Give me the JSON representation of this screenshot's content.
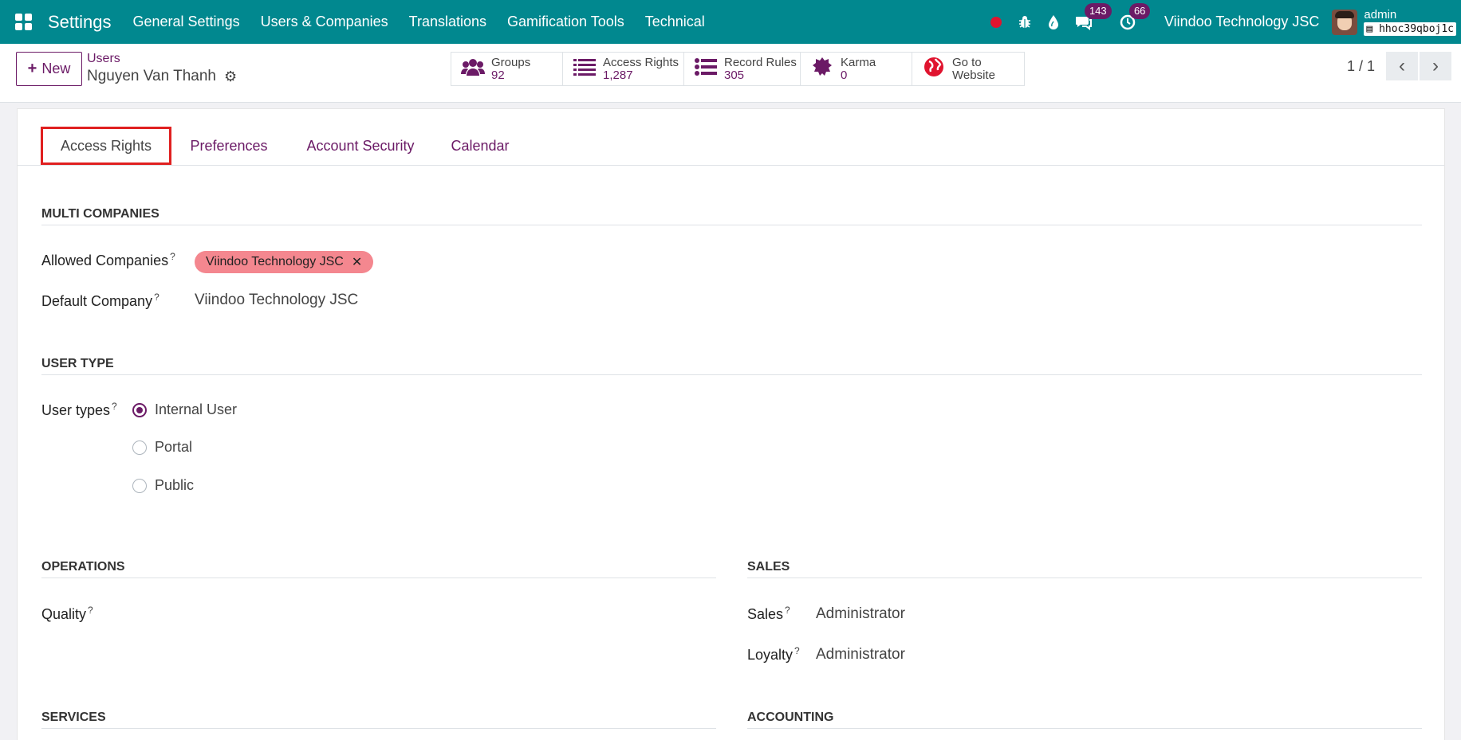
{
  "navbar": {
    "app_title": "Settings",
    "menu": [
      "General Settings",
      "Users & Companies",
      "Translations",
      "Gamification Tools",
      "Technical"
    ],
    "messages_badge": "143",
    "activities_badge": "66",
    "company": "Viindoo Technology JSC",
    "user": "admin",
    "database": "hhoc39qboj1c"
  },
  "control": {
    "new_label": "New",
    "breadcrumb": "Users",
    "record_name": "Nguyen Van Thanh",
    "stats": [
      {
        "label": "Groups",
        "value": "92",
        "icon": "users-icon"
      },
      {
        "label": "Access Rights",
        "value": "1,287",
        "icon": "list-icon"
      },
      {
        "label": "Record Rules",
        "value": "305",
        "icon": "list-icon"
      },
      {
        "label": "Karma",
        "value": "0",
        "icon": "karma-icon"
      },
      {
        "label": "Go to",
        "value": "Website",
        "icon": "globe-icon"
      }
    ],
    "pager": "1 / 1"
  },
  "tabs": [
    "Access Rights",
    "Preferences",
    "Account Security",
    "Calendar"
  ],
  "form": {
    "multi_companies": {
      "title": "MULTI COMPANIES",
      "allowed_label": "Allowed Companies",
      "allowed_tag": "Viindoo Technology JSC",
      "default_label": "Default Company",
      "default_value": "Viindoo Technology JSC"
    },
    "user_type": {
      "title": "USER TYPE",
      "label": "User types",
      "options": [
        "Internal User",
        "Portal",
        "Public"
      ],
      "selected": "Internal User"
    },
    "operations": {
      "title": "OPERATIONS",
      "quality_label": "Quality"
    },
    "sales": {
      "title": "SALES",
      "sales_label": "Sales",
      "sales_value": "Administrator",
      "loyalty_label": "Loyalty",
      "loyalty_value": "Administrator"
    },
    "services": {
      "title": "SERVICES"
    },
    "accounting": {
      "title": "ACCOUNTING"
    }
  },
  "colors": {
    "navbar": "#01888f",
    "primary": "#6b1a66",
    "tag": "#f4878f"
  }
}
